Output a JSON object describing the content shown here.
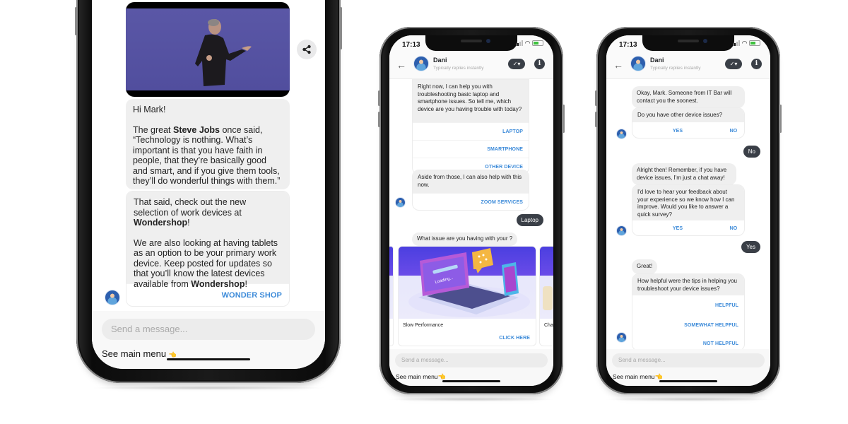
{
  "phone1": {
    "messages": {
      "greeting": "Hi Mark!",
      "quote_intro_pre": "The great ",
      "quote_name": "Steve Jobs",
      "quote_intro_post": " once said,",
      "quote_text": "“Technology is nothing. What’s important is that you have faith in people, that they’re basically good and smart, and if you give them tools, they’ll do wonderful things with them.”",
      "promo_pre": "That said, check out the new selection of work devices at ",
      "promo_brand": "Wondershop",
      "promo_post": "!",
      "tablets_pre": "We are also looking at having tablets as an option to be your primary work device. Keep posted for updates so that you’ll know the latest devices available from ",
      "tablets_brand": "Wondershop",
      "tablets_post": "!",
      "button": "WONDER SHOP"
    },
    "composer_placeholder": "Send a message...",
    "menu_link": "See main menu",
    "menu_emoji": "👈"
  },
  "phone2": {
    "status_time": "17:13",
    "contact_name": "Dani",
    "contact_sub": "Typically replies instantly",
    "toggle_label": "✓▾",
    "info_label": "i",
    "back_label": "←",
    "q1": "Right now, I can help you with troubleshooting basic laptop and smartphone issues. So tell me, which device are you having trouble with today?",
    "q1_options": [
      "LAPTOP",
      "SMARTPHONE",
      "OTHER DEVICE"
    ],
    "q2": "Aside from those, I can also help with this now.",
    "q2_options": [
      "ZOOM SERVICES"
    ],
    "user_reply": "Laptop",
    "q3": "What issue are you having with your ?",
    "carousel": [
      {
        "title": "Slow Performance",
        "cta": "CLICK HERE",
        "image_text": "Loading..."
      },
      {
        "title": "Cha"
      }
    ],
    "composer_placeholder": "Send a message...",
    "menu_link": "See main menu",
    "menu_emoji": "👈"
  },
  "phone3": {
    "status_time": "17:13",
    "contact_name": "Dani",
    "contact_sub": "Typically replies instantly",
    "toggle_label": "✓▾",
    "info_label": "i",
    "back_label": "←",
    "m1": "Okay, Mark. Someone from IT Bar will contact you the soonest.",
    "q1": "Do you have other device issues?",
    "q1_options": [
      "YES",
      "NO"
    ],
    "reply1": "No",
    "m2": "Alright then! Remember, if you have device issues, I'm just a chat away!",
    "q2": "I'd love to hear your feedback about your experience so we know how I can improve. Would you like to answer a quick survey?",
    "q2_options": [
      "YES",
      "NO"
    ],
    "reply2": "Yes",
    "m3": "Great!",
    "q3": "How helpful were the tips in helping you troubleshoot your device issues?",
    "q3_options": [
      "HELPFUL",
      "SOMEWHAT HELPFUL",
      "NOT HELPFUL"
    ],
    "composer_placeholder": "Send a message...",
    "menu_link": "See main menu",
    "menu_emoji": "👈"
  },
  "colors": {
    "accent_link": "#3d8bd9",
    "bot_bubble": "#efefef",
    "user_bubble": "#3a3f47",
    "video_bg": "#5a57a6"
  }
}
